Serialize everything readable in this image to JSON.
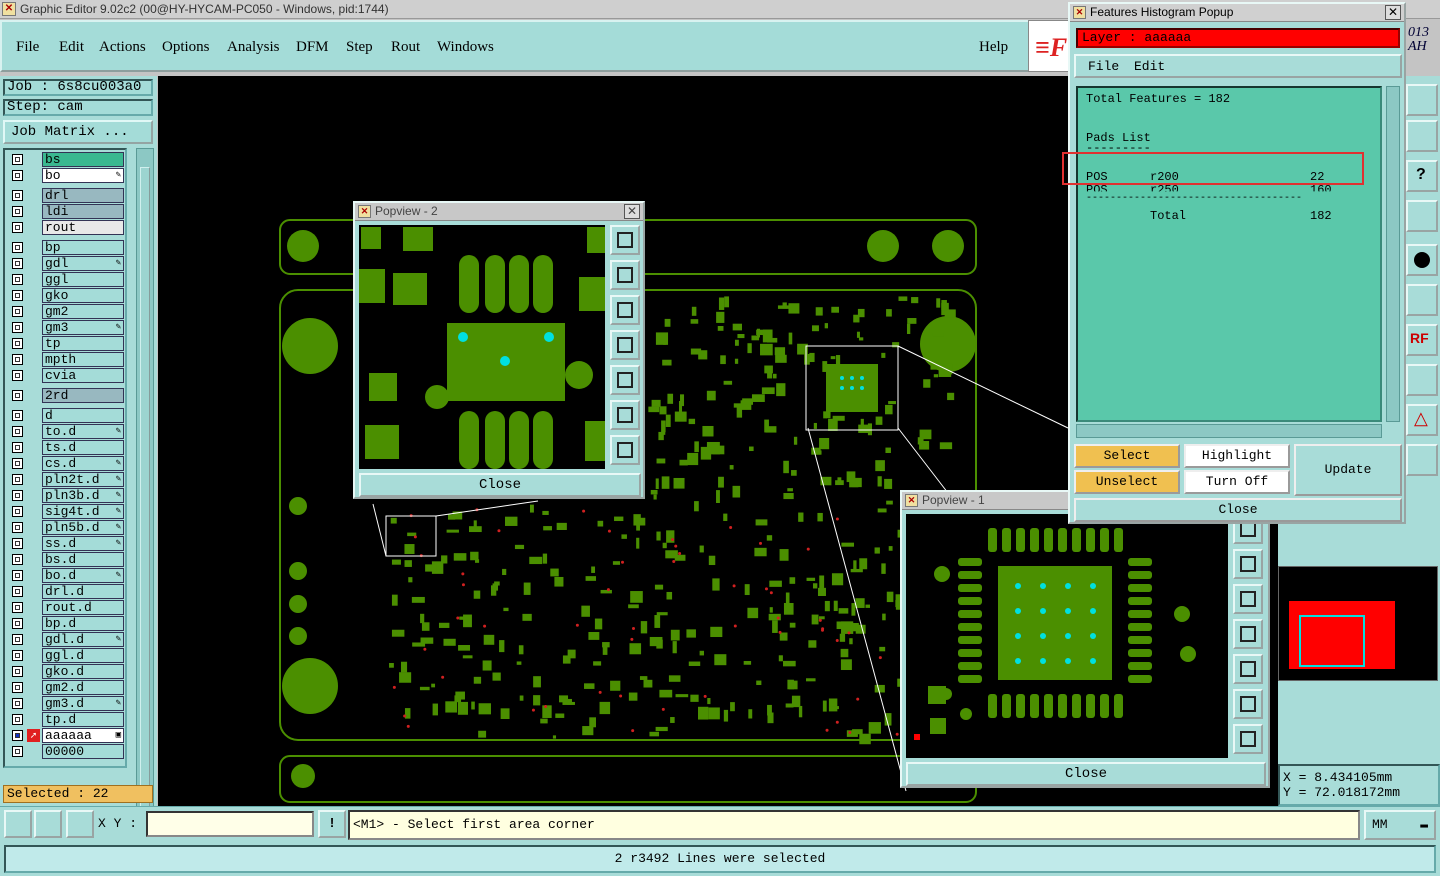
{
  "window": {
    "title": "Graphic Editor 9.02c2 (00@HY-HYCAM-PC050 - Windows, pid:1744)"
  },
  "menu": {
    "items": [
      "File",
      "Edit",
      "Actions",
      "Options",
      "Analysis",
      "DFM",
      "Step",
      "Rout",
      "Windows"
    ],
    "help": "Help"
  },
  "job": {
    "job_label": "Job : 6s8cu003a0",
    "step_label": "Step: cam",
    "matrix_button": "Job Matrix ..."
  },
  "layers": [
    {
      "name": "bs",
      "state": "board"
    },
    {
      "name": "bo",
      "state": "work",
      "mark": "✎"
    },
    {
      "name": "drl",
      "state": "drill"
    },
    {
      "name": "ldi",
      "state": "drill"
    },
    {
      "name": "rout",
      "state": "rout"
    },
    {
      "name": "bp",
      "state": "normal"
    },
    {
      "name": "gdl",
      "state": "normal",
      "mark": "✎"
    },
    {
      "name": "ggl",
      "state": "normal"
    },
    {
      "name": "gko",
      "state": "normal"
    },
    {
      "name": "gm2",
      "state": "normal"
    },
    {
      "name": "gm3",
      "state": "normal",
      "mark": "✎"
    },
    {
      "name": "tp",
      "state": "normal"
    },
    {
      "name": "mpth",
      "state": "normal"
    },
    {
      "name": "cvia",
      "state": "normal"
    },
    {
      "name": "2rd",
      "state": "drill"
    },
    {
      "name": "d",
      "state": "normal"
    },
    {
      "name": "to.d",
      "state": "normal",
      "mark": "✎"
    },
    {
      "name": "ts.d",
      "state": "normal"
    },
    {
      "name": "cs.d",
      "state": "normal",
      "mark": "✎"
    },
    {
      "name": "pln2t.d",
      "state": "normal",
      "mark": "✎"
    },
    {
      "name": "pln3b.d",
      "state": "normal",
      "mark": "✎"
    },
    {
      "name": "sig4t.d",
      "state": "normal",
      "mark": "✎"
    },
    {
      "name": "pln5b.d",
      "state": "normal",
      "mark": "✎"
    },
    {
      "name": "ss.d",
      "state": "normal",
      "mark": "✎"
    },
    {
      "name": "bs.d",
      "state": "normal"
    },
    {
      "name": "bo.d",
      "state": "normal",
      "mark": "✎"
    },
    {
      "name": "drl.d",
      "state": "normal"
    },
    {
      "name": "rout.d",
      "state": "normal"
    },
    {
      "name": "bp.d",
      "state": "normal"
    },
    {
      "name": "gdl.d",
      "state": "normal",
      "mark": "✎"
    },
    {
      "name": "ggl.d",
      "state": "normal"
    },
    {
      "name": "gko.d",
      "state": "normal"
    },
    {
      "name": "gm2.d",
      "state": "normal"
    },
    {
      "name": "gm3.d",
      "state": "normal",
      "mark": "✎"
    },
    {
      "name": "tp.d",
      "state": "normal"
    },
    {
      "name": "aaaaaa",
      "state": "affected",
      "mark": "▣"
    },
    {
      "name": "00000",
      "state": "normal"
    }
  ],
  "selected_count": "Selected : 22",
  "popview2": {
    "title": "Popview - 2",
    "close": "Close"
  },
  "popview1": {
    "title": "Popview - 1",
    "close": "Close"
  },
  "histogram": {
    "title": "Features Histogram Popup",
    "layer": "Layer :  aaaaaa",
    "menu": [
      "File",
      "Edit"
    ],
    "total_features": "Total Features = 182",
    "pads_header": "Pads List",
    "pads_rule": "---------",
    "rows": [
      {
        "pol": "POS",
        "sym": "r200",
        "count": "22"
      },
      {
        "pol": "POS",
        "sym": "r250",
        "count": "160"
      }
    ],
    "total_rule": "------------------------------------",
    "total_label": "Total",
    "total_value": "182",
    "buttons": {
      "select": "Select",
      "highlight": "Highlight",
      "update": "Update",
      "unselect": "Unselect",
      "turn_off": "Turn Off",
      "close": "Close"
    }
  },
  "coords": {
    "x": "X = 8.434105mm",
    "y": "Y = 72.018172mm"
  },
  "bottom": {
    "xy_label": "X Y :",
    "xy_value": "",
    "help_message": "<M1> - Select first area corner",
    "units": "MM",
    "status": "2 r3492 Lines were selected"
  },
  "partial_banner": "013\nAH",
  "colors": {
    "board": "#4b8f00",
    "panel": "#a8dcd8",
    "selection_red": "#ff0000",
    "highlight": "#00e0e0"
  }
}
